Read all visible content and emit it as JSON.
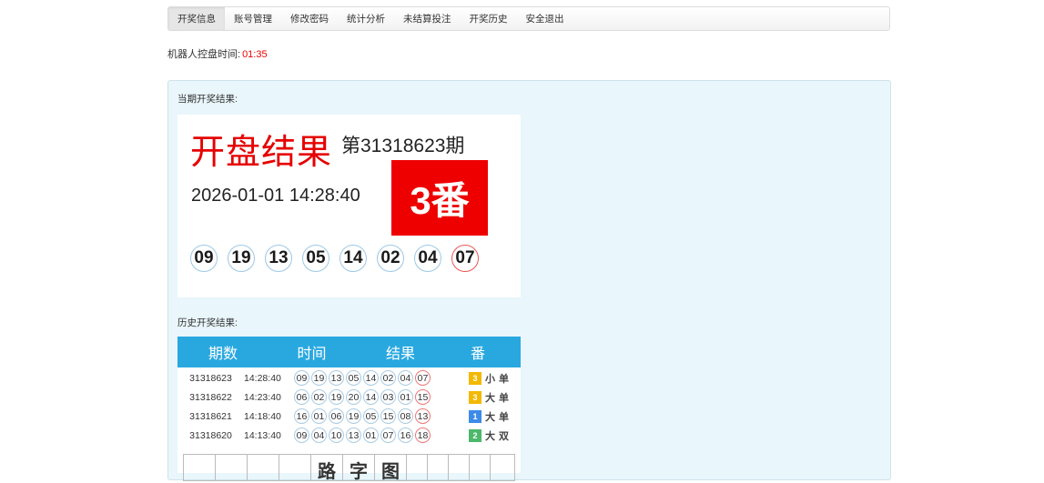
{
  "nav": {
    "tabs": [
      {
        "label": "开奖信息",
        "active": true
      },
      {
        "label": "账号管理"
      },
      {
        "label": "修改密码"
      },
      {
        "label": "统计分析"
      },
      {
        "label": "未结算投注"
      },
      {
        "label": "开奖历史"
      },
      {
        "label": "安全退出"
      }
    ]
  },
  "robot": {
    "label": "机器人控盘时间:",
    "time": "01:35"
  },
  "current": {
    "section_label": "当期开奖结果:",
    "title": "开盘结果",
    "period": "第31318623期",
    "datetime": "2026-01-01 14:28:40",
    "fan": "3番",
    "balls": [
      "09",
      "19",
      "13",
      "05",
      "14",
      "02",
      "04",
      "07"
    ]
  },
  "history": {
    "section_label": "历史开奖结果:",
    "headers": [
      "期数",
      "时间",
      "结果",
      "番"
    ],
    "rows": [
      {
        "period": "31318623",
        "time": "14:28:40",
        "nums": [
          "09",
          "19",
          "13",
          "05",
          "14",
          "02",
          "04",
          "07"
        ],
        "fan": "3",
        "size": "小",
        "parity": "单",
        "fan_color": "#f3b800"
      },
      {
        "period": "31318622",
        "time": "14:23:40",
        "nums": [
          "06",
          "02",
          "19",
          "20",
          "14",
          "03",
          "01",
          "15"
        ],
        "fan": "3",
        "size": "大",
        "parity": "单",
        "fan_color": "#f3b800"
      },
      {
        "period": "31318621",
        "time": "14:18:40",
        "nums": [
          "16",
          "01",
          "06",
          "19",
          "05",
          "15",
          "08",
          "13"
        ],
        "fan": "1",
        "size": "大",
        "parity": "单",
        "fan_color": "#3d8be8"
      },
      {
        "period": "31318620",
        "time": "14:13:40",
        "nums": [
          "09",
          "04",
          "10",
          "13",
          "01",
          "07",
          "16",
          "18"
        ],
        "fan": "2",
        "size": "大",
        "parity": "双",
        "fan_color": "#4cb86a"
      }
    ],
    "road_chars": [
      "路",
      "字",
      "图"
    ]
  },
  "colors": {
    "accent": "#29a8e0",
    "red": "#ee0000",
    "panel": "#e9f6fb"
  }
}
